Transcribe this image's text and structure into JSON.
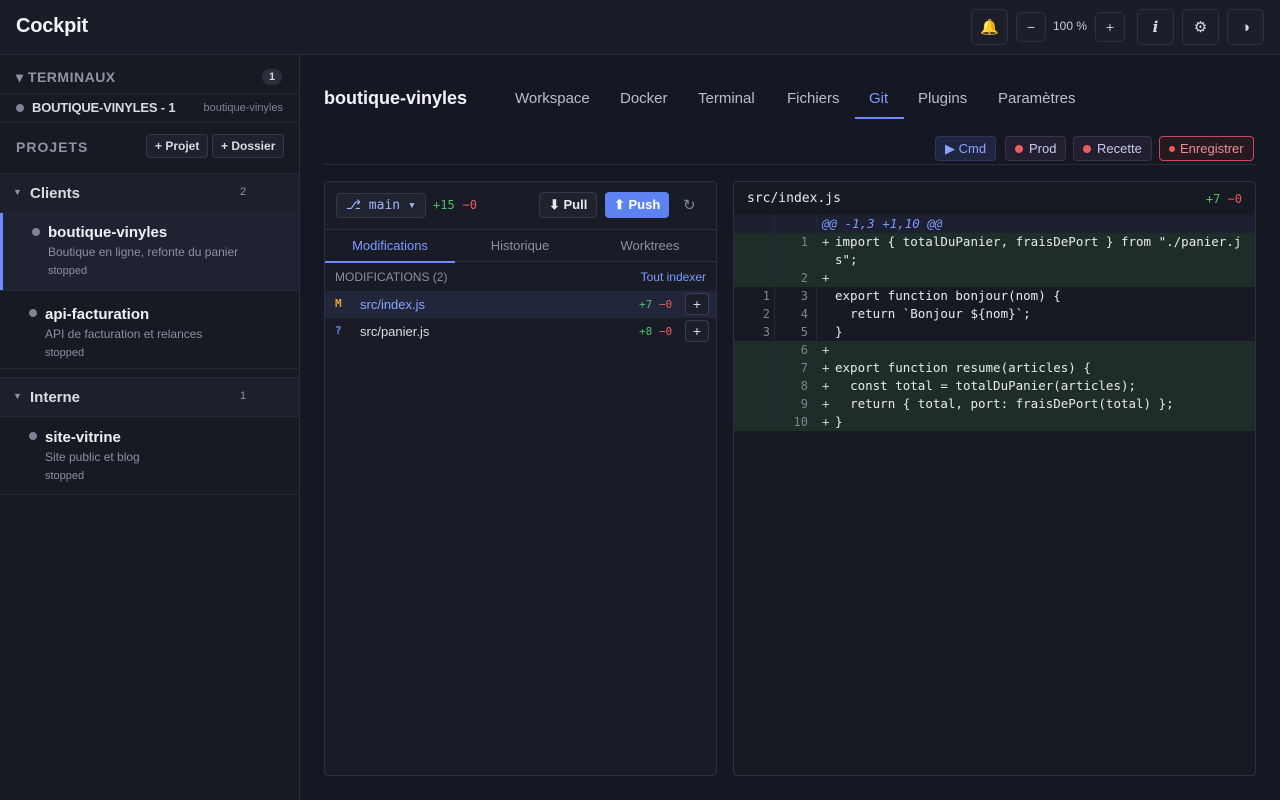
{
  "app": {
    "title": "Cockpit"
  },
  "topbar": {
    "bell_icon": "bell-icon",
    "zoom_out": "−",
    "zoom_level": "100 %",
    "zoom_in": "+",
    "info": "i",
    "settings_icon": "gear-icon",
    "theme_icon": "half-circle-icon"
  },
  "sidebar": {
    "terminals_header": "▾ TERMINAUX",
    "terminals_count": "1",
    "terminal": {
      "name": "BOUTIQUE-VINYLES - 1",
      "project": "boutique-vinyles"
    },
    "projects_header": "PROJETS",
    "add_project": "+ Projet",
    "add_folder": "+ Dossier",
    "groups": [
      {
        "name": "Clients",
        "count": "2",
        "projects": [
          {
            "name": "boutique-vinyles",
            "desc": "Boutique en ligne, refonte du panier",
            "status": "stopped"
          },
          {
            "name": "api-facturation",
            "desc": "API de facturation et relances",
            "status": "stopped"
          }
        ]
      },
      {
        "name": "Interne",
        "count": "1",
        "projects": [
          {
            "name": "site-vitrine",
            "desc": "Site public et blog",
            "status": "stopped"
          }
        ]
      }
    ]
  },
  "main": {
    "project_title": "boutique-vinyles",
    "tabs": [
      "Workspace",
      "Docker",
      "Terminal",
      "Fichiers",
      "Git",
      "Plugins",
      "Paramètres"
    ],
    "active_tab": "Git",
    "actions": {
      "cmd": "▶ Cmd",
      "prod": "Prod",
      "recette": "Recette",
      "record": "Enregistrer"
    }
  },
  "git": {
    "branch": "⎇ main ▾",
    "added": "+15",
    "removed": "−0",
    "pull": "⬇ Pull",
    "push": "⬆ Push",
    "refresh": "↻",
    "subtabs": [
      "Modifications",
      "Historique",
      "Worktrees"
    ],
    "mods_header": "MODIFICATIONS (2)",
    "index_all": "Tout indexer",
    "files": [
      {
        "status": "M",
        "name": "src/index.js",
        "added": "+7",
        "removed": "−0",
        "stage": "+"
      },
      {
        "status": "?",
        "name": "src/panier.js",
        "added": "+8",
        "removed": "−0",
        "stage": "+"
      }
    ]
  },
  "diff": {
    "file": "src/index.js",
    "added": "+7",
    "removed": "−0",
    "hunk": "@@ -1,3 +1,10 @@",
    "lines": [
      {
        "type": "add",
        "old": "",
        "new": "1",
        "sign": "+",
        "code": "import { totalDuPanier, fraisDePort } from \"./panier.js\";"
      },
      {
        "type": "add",
        "old": "",
        "new": "2",
        "sign": "+",
        "code": ""
      },
      {
        "type": "ctx",
        "old": "1",
        "new": "3",
        "sign": "",
        "code": "export function bonjour(nom) {"
      },
      {
        "type": "ctx",
        "old": "2",
        "new": "4",
        "sign": "",
        "code": "  return `Bonjour ${nom}`;"
      },
      {
        "type": "ctx",
        "old": "3",
        "new": "5",
        "sign": "",
        "code": "}"
      },
      {
        "type": "add",
        "old": "",
        "new": "6",
        "sign": "+",
        "code": ""
      },
      {
        "type": "add",
        "old": "",
        "new": "7",
        "sign": "+",
        "code": "export function resume(articles) {"
      },
      {
        "type": "add",
        "old": "",
        "new": "8",
        "sign": "+",
        "code": "  const total = totalDuPanier(articles);"
      },
      {
        "type": "add",
        "old": "",
        "new": "9",
        "sign": "+",
        "code": "  return { total, port: fraisDePort(total) };"
      },
      {
        "type": "add",
        "old": "",
        "new": "10",
        "sign": "+",
        "code": "}"
      }
    ]
  },
  "colors": {
    "accent": "#6c8cff",
    "add": "#4fbf6a",
    "remove": "#ef5b5b",
    "modified": "#e0a23a"
  }
}
